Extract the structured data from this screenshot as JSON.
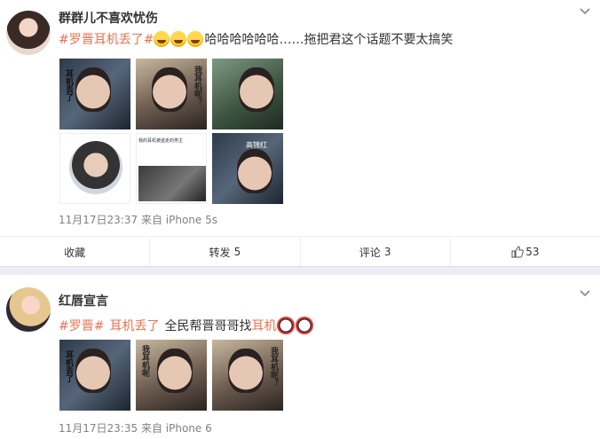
{
  "posts": [
    {
      "nickname": "群群儿不喜欢忧伤",
      "text": {
        "hashtag": "#罗晋耳机丢了#",
        "emoji_count": 3,
        "body": "哈哈哈哈哈哈……拖把君这个话题不要太搞笑"
      },
      "images": [
        {
          "style": "dark",
          "caption": "耳机丢了"
        },
        {
          "style": "warm",
          "caption": "我耳机呢？"
        },
        {
          "style": "green",
          "caption": ""
        },
        {
          "style": "white",
          "caption": ""
        },
        {
          "style": "white",
          "caption": "我的耳机被盗走的男主"
        },
        {
          "style": "dark",
          "caption": "高锦红"
        }
      ],
      "timestamp": "11月17日23:37",
      "source": "来自 iPhone 5s",
      "actions": {
        "collect_label": "收藏",
        "repost_label": "转发",
        "repost_count": "5",
        "comment_label": "评论",
        "comment_count": "3",
        "like_count": "53"
      }
    },
    {
      "nickname": "红唇宣言",
      "text": {
        "hashtag1": "#罗晋#",
        "hashtag2": "耳机丢了",
        "body": "全民帮晋哥哥找",
        "link": "耳机",
        "emoji_count": 2
      },
      "images": [
        {
          "style": "dark",
          "caption": "耳机丢了"
        },
        {
          "style": "warm",
          "caption": "我耳机呢"
        },
        {
          "style": "warm",
          "caption": "我耳机呢？"
        }
      ],
      "timestamp": "11月17日23:35",
      "source": "来自 iPhone 6"
    }
  ],
  "colors": {
    "link": "#eb7350",
    "meta": "#808080",
    "separator": "#eaeef3"
  },
  "icons": [
    "chevron-down-icon",
    "like-icon",
    "emoji-laugh-icon",
    "emoji-face-icon"
  ]
}
